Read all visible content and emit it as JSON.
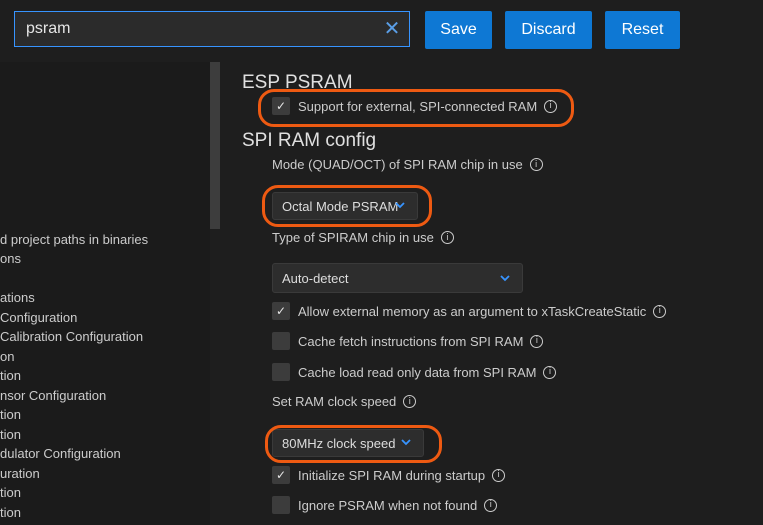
{
  "search": {
    "value": "psram",
    "clear_glyph": "✕"
  },
  "toolbar": {
    "save": "Save",
    "discard": "Discard",
    "reset": "Reset"
  },
  "tree": [
    "d project paths in binaries",
    "ons",
    "ations",
    "Configuration",
    "Calibration Configuration",
    "on",
    "tion",
    "nsor Configuration",
    "tion",
    "tion",
    "dulator Configuration",
    "uration",
    "tion",
    "tion"
  ],
  "esp_psram": {
    "heading": "ESP PSRAM",
    "support_label": "Support for external, SPI-connected RAM",
    "support_checked": true
  },
  "spi_ram_config": {
    "heading": "SPI RAM config",
    "mode_label": "Mode (QUAD/OCT) of SPI RAM chip in use",
    "mode_value": "Octal Mode PSRAM",
    "type_label": "Type of SPIRAM chip in use",
    "type_value": "Auto-detect",
    "allow_label": "Allow external memory as an argument to xTaskCreateStatic",
    "allow_checked": true,
    "cache_fetch_label": "Cache fetch instructions from SPI RAM",
    "cache_fetch_checked": false,
    "cache_load_label": "Cache load read only data from SPI RAM",
    "cache_load_checked": false,
    "clock_label": "Set RAM clock speed",
    "clock_value": "80MHz clock speed",
    "init_label": "Initialize SPI RAM during startup",
    "init_checked": true,
    "ignore_label": "Ignore PSRAM when not found",
    "ignore_checked": false
  },
  "glyphs": {
    "check": "✓",
    "info": "i"
  },
  "colors": {
    "accent": "#0e78d4",
    "highlight": "#ee5a12",
    "focus": "#3794ff"
  },
  "icons": {
    "clear": "close-icon",
    "dropdown": "chevron-down-icon",
    "info": "info-icon"
  }
}
